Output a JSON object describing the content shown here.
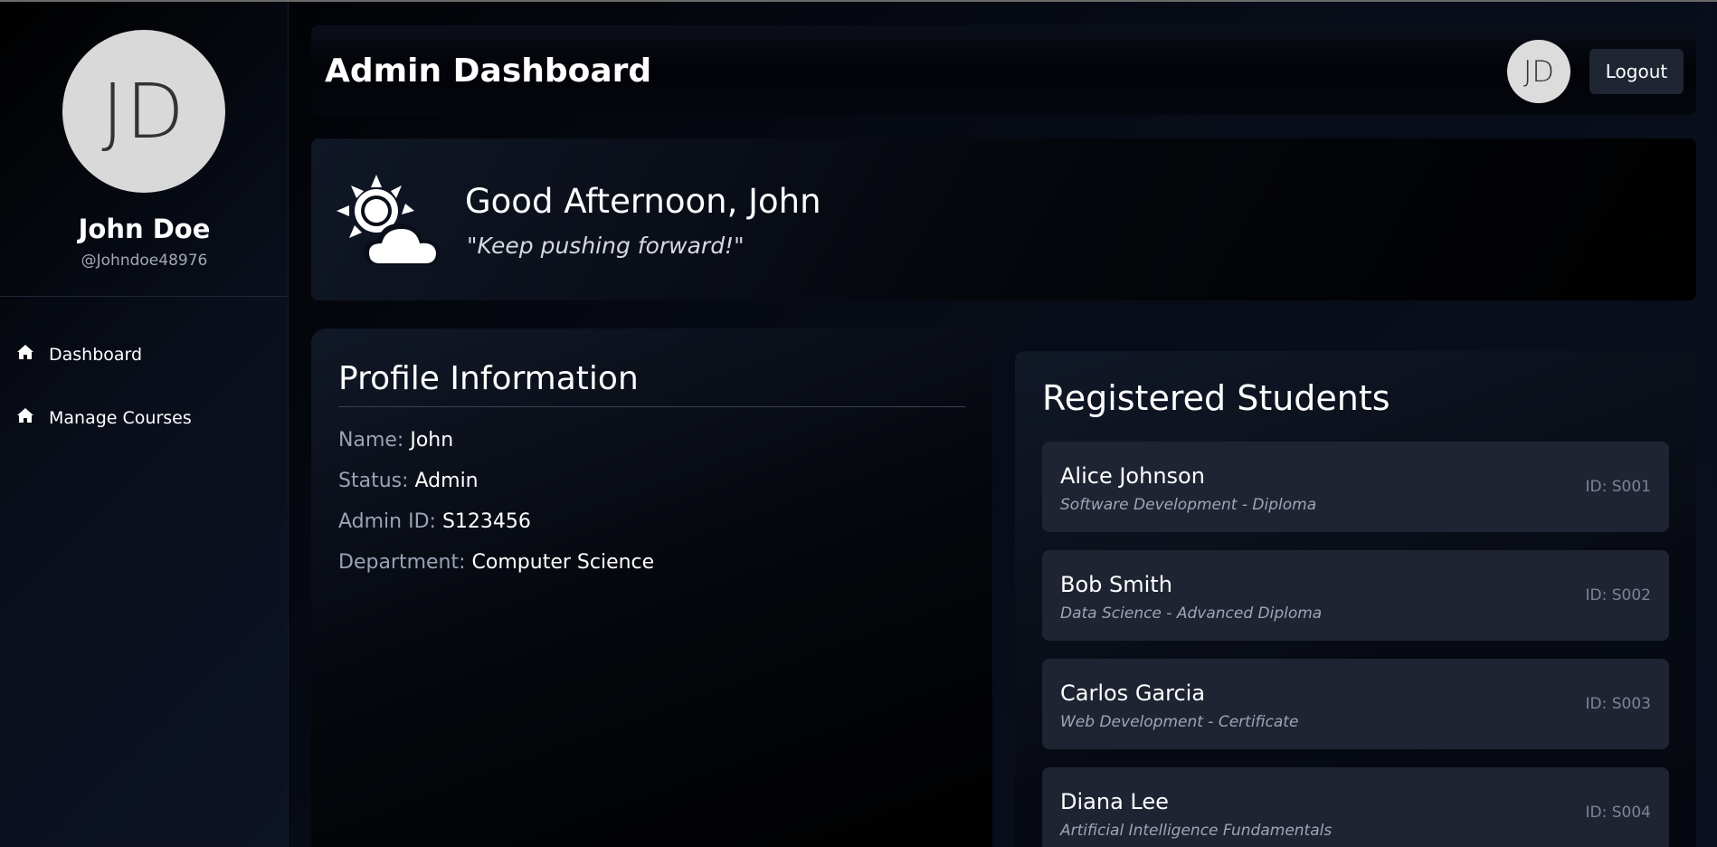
{
  "sidebar": {
    "avatar_initials": "JD",
    "user_name": "John Doe",
    "user_handle": "@Johndoe48976",
    "nav": [
      {
        "label": "Dashboard",
        "icon": "home-icon"
      },
      {
        "label": "Manage Courses",
        "icon": "home-icon"
      }
    ]
  },
  "header": {
    "title": "Admin Dashboard",
    "avatar_initials": "JD",
    "logout_label": "Logout"
  },
  "greeting": {
    "icon": "sun-cloud-icon",
    "title": "Good Afternoon, John",
    "quote": "\"Keep pushing forward!\""
  },
  "profile": {
    "title": "Profile Information",
    "fields": [
      {
        "label": "Name:",
        "value": "John"
      },
      {
        "label": "Status:",
        "value": "Admin"
      },
      {
        "label": "Admin ID:",
        "value": "S123456"
      },
      {
        "label": "Department:",
        "value": "Computer Science"
      }
    ]
  },
  "students": {
    "title": "Registered Students",
    "items": [
      {
        "name": "Alice Johnson",
        "course": "Software Development - Diploma",
        "id": "ID: S001"
      },
      {
        "name": "Bob Smith",
        "course": "Data Science - Advanced Diploma",
        "id": "ID: S002"
      },
      {
        "name": "Carlos Garcia",
        "course": "Web Development - Certificate",
        "id": "ID: S003"
      },
      {
        "name": "Diana Lee",
        "course": "Artificial Intelligence Fundamentals",
        "id": "ID: S004"
      }
    ]
  },
  "colors": {
    "background": "#000000",
    "card": "#1f2433",
    "muted_label": "#9aa3b5"
  }
}
